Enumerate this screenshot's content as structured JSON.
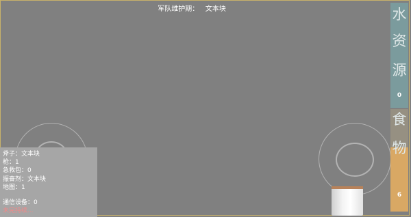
{
  "status_bar": {
    "label": "军队维护期：",
    "value": "文本块"
  },
  "inventory": {
    "axe": {
      "label": "斧子：",
      "value": "文本块"
    },
    "gun": {
      "label": "枪：",
      "value": "1"
    },
    "medkit": {
      "label": "急救包：",
      "value": "0"
    },
    "stimulant": {
      "label": "振奋剂：",
      "value": "文本块"
    },
    "map": {
      "label": "地图：",
      "value": "1"
    },
    "comm": {
      "label": "通信设备：",
      "value": "0"
    },
    "hint": "未完持续..."
  },
  "water_gauge": {
    "chars": [
      "水",
      "资",
      "源"
    ],
    "value": "0",
    "level": 0,
    "color": "#7b9b9d"
  },
  "food_gauge": {
    "chars": [
      "食",
      "物"
    ],
    "value": "6",
    "level": 0.63,
    "color": "#d9a864"
  },
  "joysticks": {
    "left": "move-joystick",
    "right": "action-joystick"
  },
  "item_card": {
    "icon": "book-card-icon"
  }
}
